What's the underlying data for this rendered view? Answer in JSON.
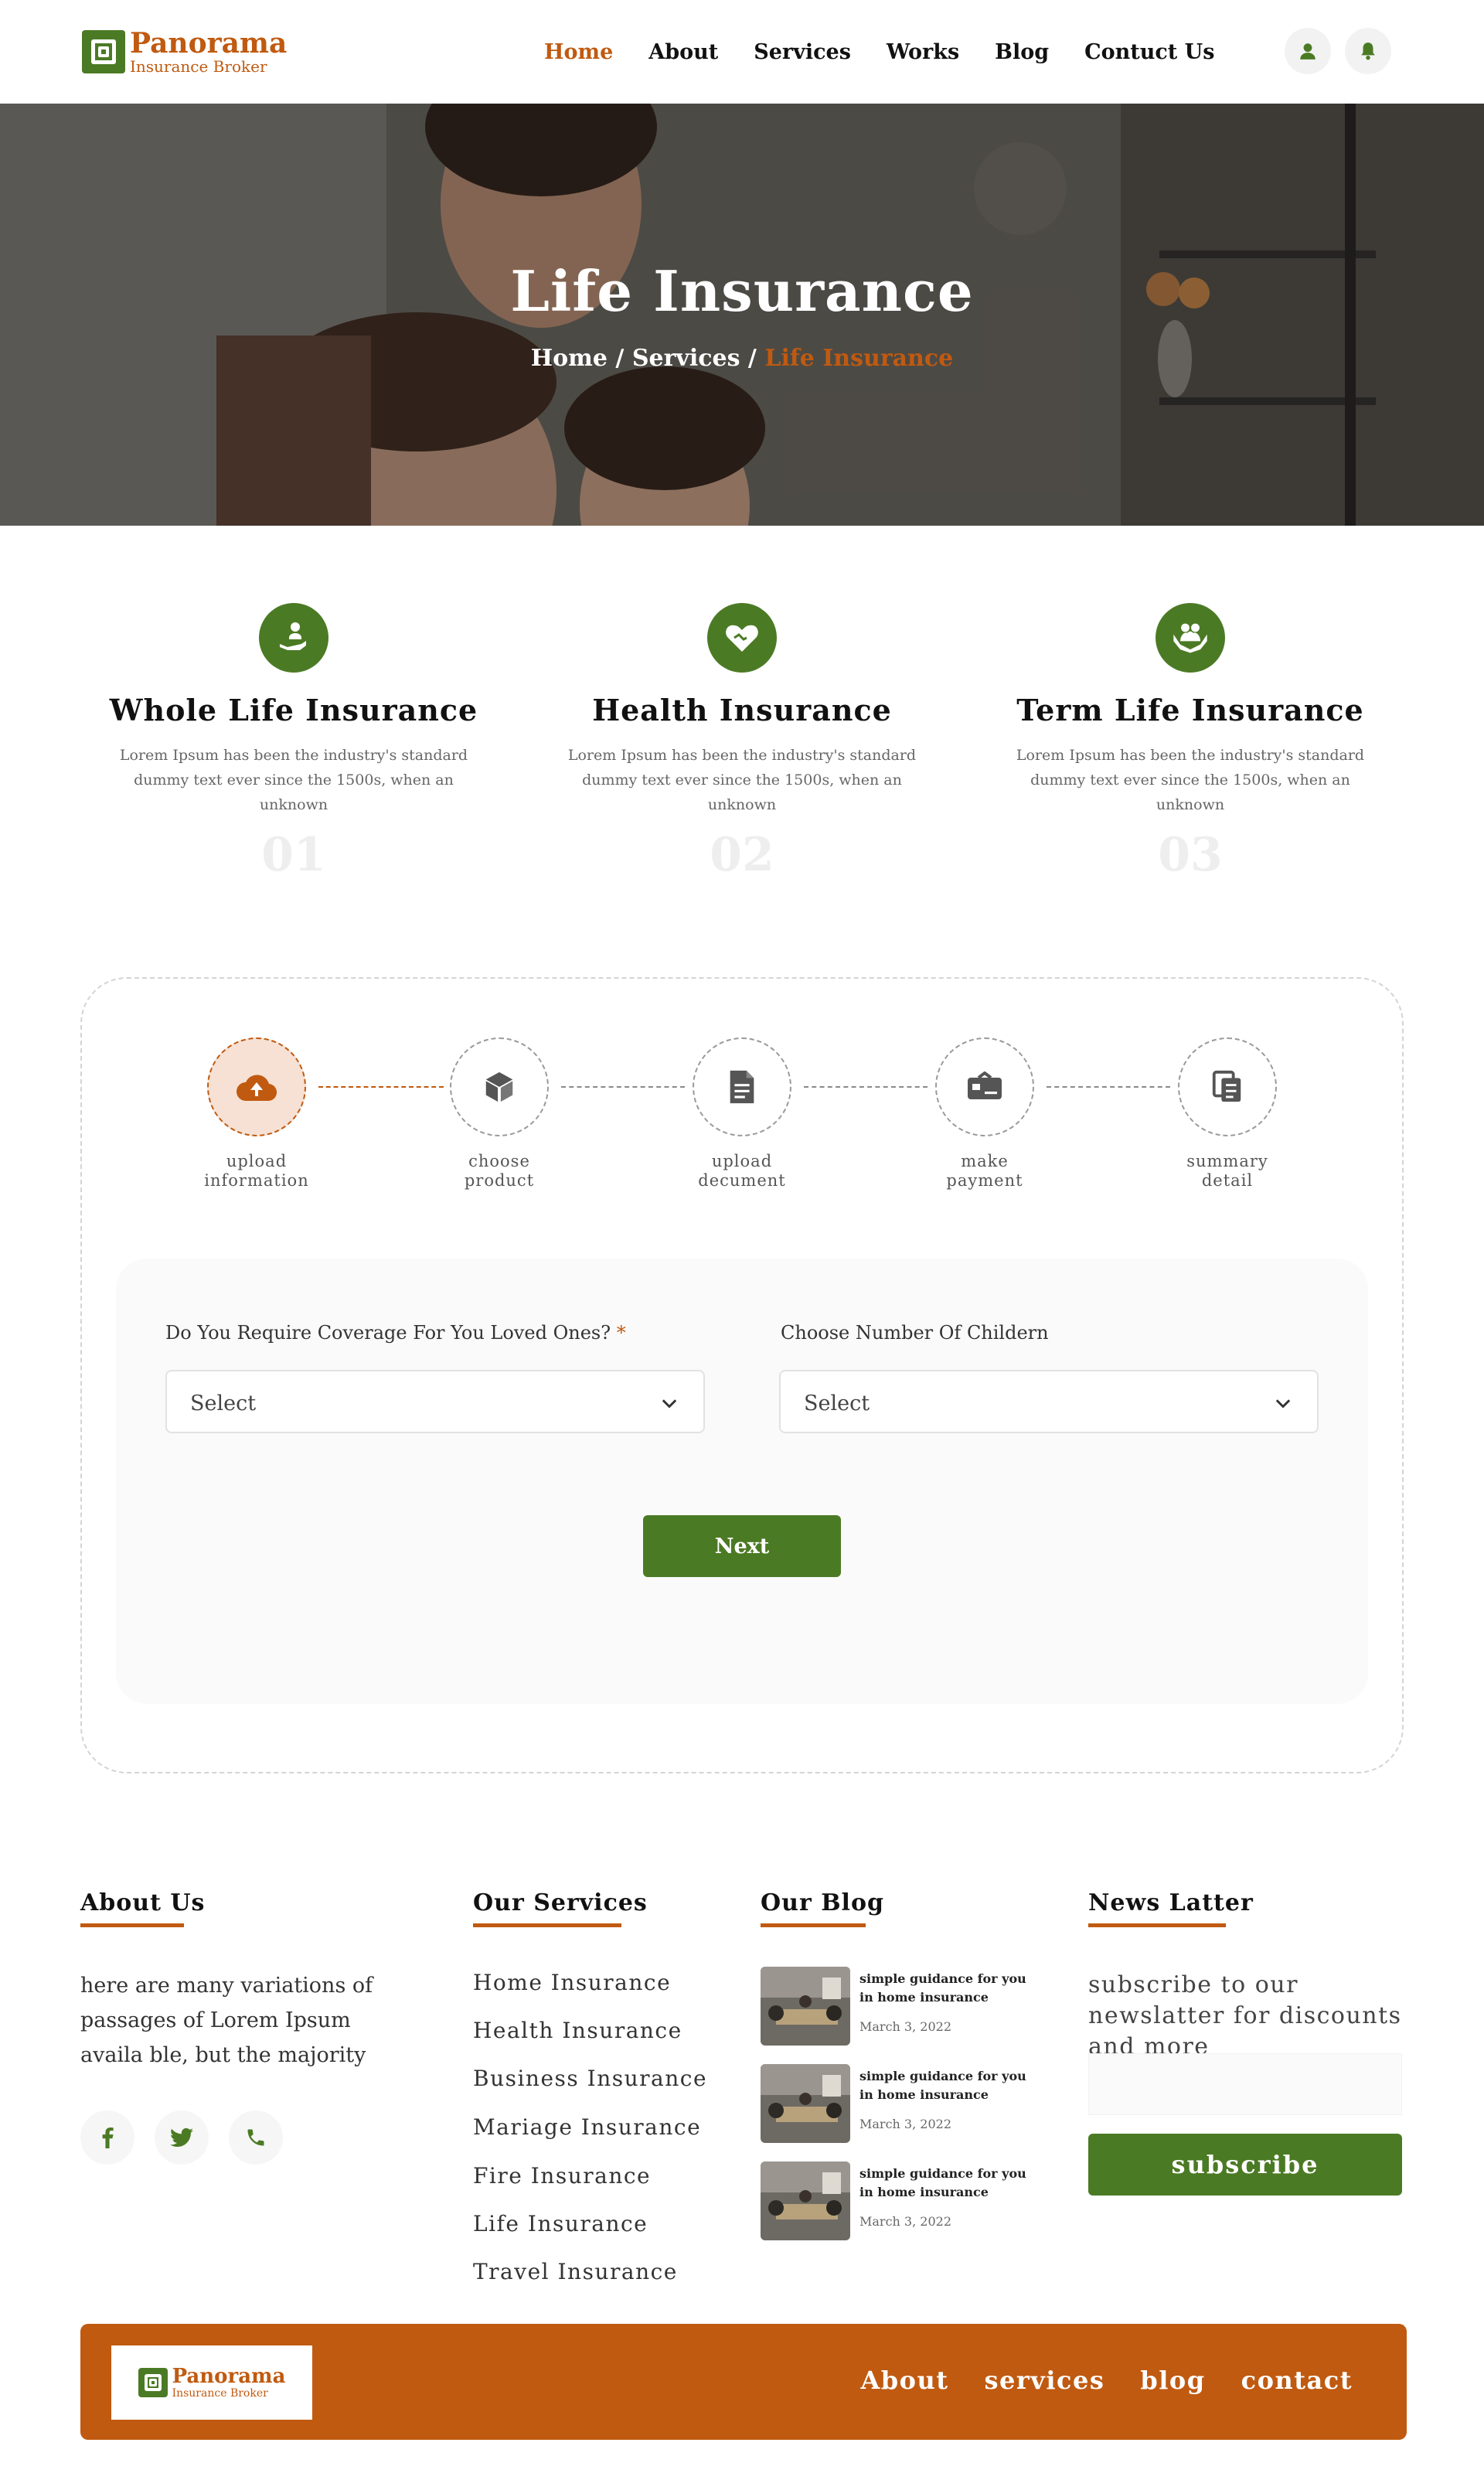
{
  "brand": {
    "name": "Panorama",
    "tagline": "Insurance Broker",
    "color_primary": "#4b7a24",
    "color_accent": "#c05a10"
  },
  "nav": {
    "items": [
      "Home",
      "About",
      "Services",
      "Works",
      "Blog",
      "Contuct Us"
    ],
    "active": "Home",
    "icons": [
      "user-icon",
      "bell-icon"
    ]
  },
  "hero": {
    "title": "Life Insurance",
    "breadcrumb": [
      "Home",
      "Services",
      "Life Insurance"
    ],
    "separator": "/"
  },
  "features": [
    {
      "title": "Whole Life Insurance",
      "desc": "Lorem Ipsum has been the industry's standard dummy text ever since the 1500s, when an unknown",
      "num": "01",
      "icon": "hand-person-icon"
    },
    {
      "title": "Health Insurance",
      "desc": "Lorem Ipsum has been the industry's standard dummy text ever since the 1500s, when an unknown",
      "num": "02",
      "icon": "heart-handshake-icon"
    },
    {
      "title": "Term Life Insurance",
      "desc": "Lorem Ipsum has been the industry's standard dummy text ever since the 1500s, when an unknown",
      "num": "03",
      "icon": "family-hands-icon"
    }
  ],
  "steps": [
    {
      "line1": "upload",
      "line2": "information",
      "icon": "cloud-upload-icon",
      "active": true
    },
    {
      "line1": "choose",
      "line2": "product",
      "icon": "box-icon",
      "active": false
    },
    {
      "line1": "upload",
      "line2": "decument",
      "icon": "document-icon",
      "active": false
    },
    {
      "line1": "make",
      "line2": "payment",
      "icon": "card-payment-icon",
      "active": false
    },
    {
      "line1": "summary",
      "line2": "detail",
      "icon": "copy-icon",
      "active": false
    }
  ],
  "form": {
    "coverage_label": "Do You Require Coverage For You Loved Ones?",
    "required_mark": "*",
    "children_label": "Choose Number Of Childern",
    "coverage_value": "Select",
    "children_value": "Select",
    "next_label": "Next"
  },
  "footer": {
    "about": {
      "heading": "About Us",
      "text": "here are many variations of passages of Lorem Ipsum availa ble, but the majority"
    },
    "social_icons": [
      "facebook-icon",
      "twitter-icon",
      "phone-icon"
    ],
    "services": {
      "heading": "Our Services",
      "items": [
        "Home Insurance",
        "Health Insurance",
        "Business Insurance",
        "Mariage Insurance",
        "Fire Insurance",
        "Life Insurance",
        "Travel Insurance"
      ]
    },
    "blog": {
      "heading": "Our Blog",
      "posts": [
        {
          "title": "simple guidance for you in home insurance",
          "date": "March 3, 2022"
        },
        {
          "title": "simple guidance for you in home insurance",
          "date": "March 3, 2022"
        },
        {
          "title": "simple guidance for you in home insurance",
          "date": "March 3, 2022"
        }
      ]
    },
    "newsletter": {
      "heading": "News Latter",
      "text": "subscribe to our newslatter for discounts and more",
      "email_placeholder": "",
      "button": "subscribe"
    },
    "bottom_links": [
      "About",
      "services",
      "blog",
      "contact"
    ]
  }
}
